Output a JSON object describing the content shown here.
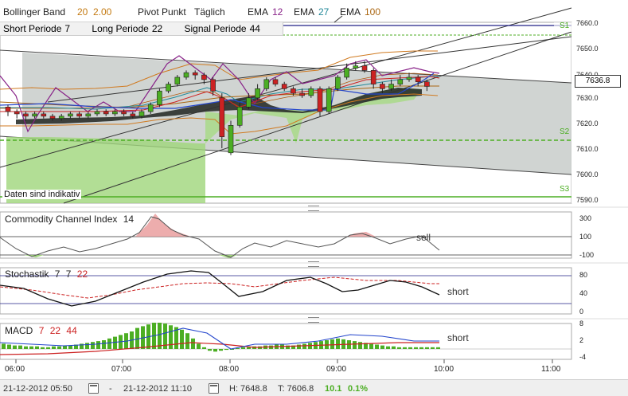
{
  "header": {
    "bb_label": "Bollinger Band",
    "bb_p1": "20",
    "bb_p2": "2.00",
    "pivot_label": "Pivot Punkt",
    "pivot_mode": "Täglich",
    "ema_label_1": "EMA",
    "ema_val_1": "12",
    "ema_label_2": "EMA",
    "ema_val_2": "27",
    "ema_label_3": "EMA",
    "ema_val_3": "100"
  },
  "legend2": {
    "short_label": "Short Periode",
    "short_val": "7",
    "long_label": "Long Periode",
    "long_val": "22",
    "signal_label": "Signal Periode",
    "signal_val": "44"
  },
  "main": {
    "indicative": "Daten sind indikativ",
    "pivot_s1": "S1",
    "pivot_s2": "S2",
    "pivot_s3": "S3",
    "current_price": "7636.8",
    "y_ticks": [
      "7660.0",
      "7650.0",
      "7640.0",
      "7630.0",
      "7620.0",
      "7610.0",
      "7600.0",
      "7590.0"
    ]
  },
  "cci": {
    "title": "Commodity Channel Index",
    "period": "14",
    "signal": "sell",
    "ticks": [
      "300",
      "100",
      "-100"
    ]
  },
  "stoch": {
    "title": "Stochastik",
    "p1": "7",
    "p2": "7",
    "p3": "22",
    "signal": "short",
    "ticks": [
      "80",
      "40",
      "0"
    ]
  },
  "macd": {
    "title": "MACD",
    "p1": "7",
    "p2": "22",
    "p3": "44",
    "signal": "short",
    "ticks": [
      "8",
      "2",
      "-4"
    ]
  },
  "time_axis": [
    "06:00",
    "07:00",
    "08:00",
    "09:00",
    "10:00",
    "11:00"
  ],
  "status": {
    "from": "21-12-2012 05:50",
    "dash": "-",
    "to": "21-12-2012 11:10",
    "high": "H: 7648.8",
    "low": "T: 7606.8",
    "change": "10.1",
    "change_pct": "0.1%"
  },
  "chart_data": {
    "type": "candlestick",
    "ylim": [
      7586,
      7665
    ],
    "candles": [
      {
        "t": "06:00",
        "o": 7628,
        "c": 7626,
        "h": 7629,
        "l": 7624
      },
      {
        "t": "06:05",
        "o": 7626,
        "c": 7625,
        "h": 7627,
        "l": 7623
      },
      {
        "t": "06:10",
        "o": 7625,
        "c": 7624,
        "h": 7626,
        "l": 7622
      },
      {
        "t": "06:15",
        "o": 7624,
        "c": 7625,
        "h": 7626,
        "l": 7623
      },
      {
        "t": "06:20",
        "o": 7625,
        "c": 7624,
        "h": 7626,
        "l": 7623
      },
      {
        "t": "06:25",
        "o": 7624,
        "c": 7623,
        "h": 7625,
        "l": 7622
      },
      {
        "t": "06:30",
        "o": 7623,
        "c": 7624,
        "h": 7625,
        "l": 7622
      },
      {
        "t": "06:35",
        "o": 7624,
        "c": 7625,
        "h": 7626,
        "l": 7623
      },
      {
        "t": "06:40",
        "o": 7625,
        "c": 7624,
        "h": 7626,
        "l": 7623
      },
      {
        "t": "06:45",
        "o": 7624,
        "c": 7625,
        "h": 7626,
        "l": 7623
      },
      {
        "t": "06:50",
        "o": 7625,
        "c": 7626,
        "h": 7627,
        "l": 7624
      },
      {
        "t": "06:55",
        "o": 7626,
        "c": 7625,
        "h": 7627,
        "l": 7624
      },
      {
        "t": "07:00",
        "o": 7625,
        "c": 7626,
        "h": 7627,
        "l": 7624
      },
      {
        "t": "07:05",
        "o": 7626,
        "c": 7625,
        "h": 7627,
        "l": 7624
      },
      {
        "t": "07:10",
        "o": 7625,
        "c": 7624,
        "h": 7626,
        "l": 7623
      },
      {
        "t": "07:15",
        "o": 7624,
        "c": 7626,
        "h": 7627,
        "l": 7623
      },
      {
        "t": "07:20",
        "o": 7626,
        "c": 7629,
        "h": 7630,
        "l": 7625
      },
      {
        "t": "07:25",
        "o": 7629,
        "c": 7635,
        "h": 7636,
        "l": 7628
      },
      {
        "t": "07:30",
        "o": 7635,
        "c": 7638,
        "h": 7639,
        "l": 7634
      },
      {
        "t": "07:35",
        "o": 7638,
        "c": 7641,
        "h": 7642,
        "l": 7637
      },
      {
        "t": "07:40",
        "o": 7641,
        "c": 7643,
        "h": 7644,
        "l": 7640
      },
      {
        "t": "07:45",
        "o": 7643,
        "c": 7642,
        "h": 7644,
        "l": 7640
      },
      {
        "t": "07:50",
        "o": 7642,
        "c": 7640,
        "h": 7643,
        "l": 7638
      },
      {
        "t": "07:55",
        "o": 7640,
        "c": 7635,
        "h": 7641,
        "l": 7633
      },
      {
        "t": "08:00",
        "o": 7632,
        "c": 7615,
        "h": 7634,
        "l": 7610
      },
      {
        "t": "08:05",
        "o": 7608,
        "c": 7620,
        "h": 7622,
        "l": 7607
      },
      {
        "t": "08:10",
        "o": 7620,
        "c": 7628,
        "h": 7630,
        "l": 7619
      },
      {
        "t": "08:15",
        "o": 7628,
        "c": 7632,
        "h": 7634,
        "l": 7627
      },
      {
        "t": "08:20",
        "o": 7632,
        "c": 7636,
        "h": 7638,
        "l": 7631
      },
      {
        "t": "08:25",
        "o": 7636,
        "c": 7640,
        "h": 7641,
        "l": 7635
      },
      {
        "t": "08:30",
        "o": 7640,
        "c": 7638,
        "h": 7641,
        "l": 7637
      },
      {
        "t": "08:35",
        "o": 7638,
        "c": 7636,
        "h": 7639,
        "l": 7635
      },
      {
        "t": "08:40",
        "o": 7636,
        "c": 7634,
        "h": 7637,
        "l": 7633
      },
      {
        "t": "08:45",
        "o": 7634,
        "c": 7633,
        "h": 7636,
        "l": 7632
      },
      {
        "t": "08:50",
        "o": 7633,
        "c": 7636,
        "h": 7637,
        "l": 7632
      },
      {
        "t": "08:55",
        "o": 7636,
        "c": 7626,
        "h": 7637,
        "l": 7624
      },
      {
        "t": "09:00",
        "o": 7626,
        "c": 7636,
        "h": 7637,
        "l": 7625
      },
      {
        "t": "09:05",
        "o": 7636,
        "c": 7641,
        "h": 7642,
        "l": 7635
      },
      {
        "t": "09:10",
        "o": 7641,
        "c": 7645,
        "h": 7647,
        "l": 7640
      },
      {
        "t": "09:15",
        "o": 7645,
        "c": 7646,
        "h": 7648,
        "l": 7644
      },
      {
        "t": "09:20",
        "o": 7646,
        "c": 7644,
        "h": 7648,
        "l": 7643
      },
      {
        "t": "09:25",
        "o": 7644,
        "c": 7638,
        "h": 7645,
        "l": 7636
      },
      {
        "t": "09:30",
        "o": 7638,
        "c": 7636,
        "h": 7639,
        "l": 7634
      },
      {
        "t": "09:35",
        "o": 7636,
        "c": 7638,
        "h": 7640,
        "l": 7635
      },
      {
        "t": "09:40",
        "o": 7638,
        "c": 7640,
        "h": 7642,
        "l": 7637
      },
      {
        "t": "09:45",
        "o": 7640,
        "c": 7641,
        "h": 7643,
        "l": 7639
      },
      {
        "t": "09:50",
        "o": 7641,
        "c": 7639,
        "h": 7642,
        "l": 7637
      },
      {
        "t": "09:55",
        "o": 7639,
        "c": 7637,
        "h": 7640,
        "l": 7635
      }
    ]
  },
  "colors": {
    "bull": "#4cae23",
    "bear": "#cc2222",
    "ema12": "#882288",
    "ema27": "#228899",
    "ema100": "#aa6611",
    "pivot": "#4cae23",
    "navy": "#222288",
    "panel_grey": "#c9cfcc"
  }
}
